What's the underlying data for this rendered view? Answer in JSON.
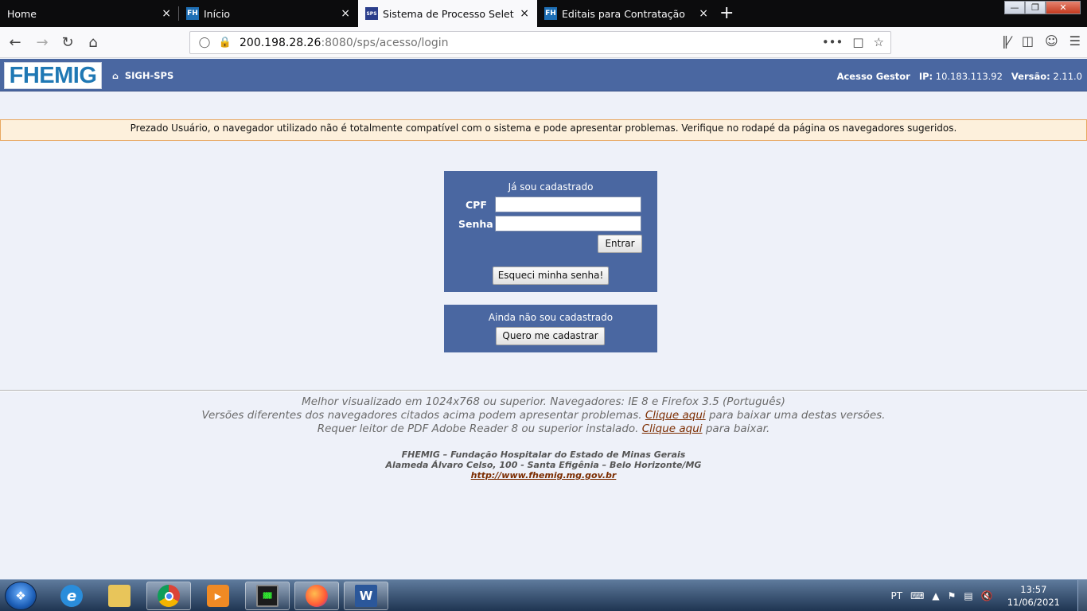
{
  "browser": {
    "tabs": [
      {
        "title": "Home",
        "favicon": "none"
      },
      {
        "title": "Início",
        "favicon": "fh-icon"
      },
      {
        "title": "Sistema de Processo Seletivo - F",
        "favicon": "sps-icon"
      },
      {
        "title": "Editais para Contratação",
        "favicon": "fh-icon"
      }
    ],
    "new_tab_glyph": "+",
    "close_glyph": "×",
    "url_host": "200.198.28.26",
    "url_rest": ":8080/sps/acesso/login",
    "url_more": "•••"
  },
  "header": {
    "logo_text": "FHEMIG",
    "home_label": "SIGH-SPS",
    "acesso_label": "Acesso Gestor",
    "ip_label": "IP:",
    "ip_value": "10.183.113.92",
    "versao_label": "Versão:",
    "versao_value": "2.11.0"
  },
  "warning": {
    "text": "Prezado Usuário, o navegador utilizado não é totalmente compatível com o sistema e pode apresentar problemas. Verifique no rodapé da página os navegadores sugeridos."
  },
  "login": {
    "heading": "Já sou cadastrado",
    "cpf_label": "CPF",
    "cpf_value": "",
    "senha_label": "Senha",
    "senha_value": "",
    "submit_label": "Entrar",
    "forgot_label": "Esqueci minha senha!"
  },
  "register": {
    "heading": "Ainda não sou cadastrado",
    "button_label": "Quero me cadastrar"
  },
  "footer": {
    "line1": "Melhor visualizado em 1024x768 ou superior. Navegadores: IE 8 e Firefox 3.5 (Português)",
    "line2_pre": "Versões diferentes dos navegadores citados acima podem apresentar problemas.",
    "line2_link": "Clique aqui",
    "line2_post": "para baixar uma destas versões.",
    "line3_pre": "Requer leitor de PDF Adobe Reader 8 ou superior instalado.",
    "line3_link": "Clique aqui",
    "line3_post": "para baixar.",
    "org_name": "FHEMIG – Fundação Hospitalar do Estado de Minas Gerais",
    "org_address": "Alameda Álvaro Celso, 100 - Santa Efigênia – Belo Horizonte/MG",
    "org_url": "http://www.fhemig.mg.gov.br"
  },
  "taskbar": {
    "language": "PT",
    "time": "13:57",
    "date": "11/06/2021"
  },
  "colors": {
    "header_blue": "#4a67a1",
    "page_bg": "#eef1f9",
    "warning_bg": "#fdf0dc",
    "warning_border": "#e8a860",
    "link_color": "#7b2c00"
  }
}
